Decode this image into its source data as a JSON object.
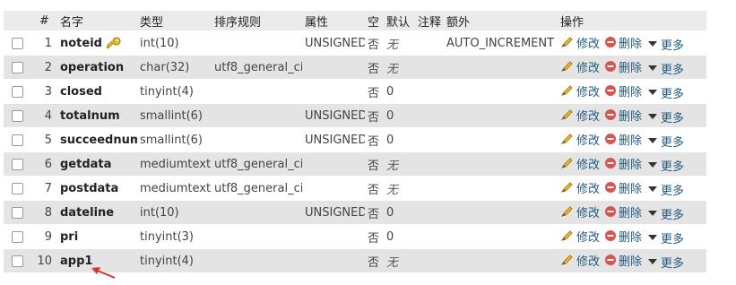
{
  "headers": {
    "index": "#",
    "name": "名字",
    "type": "类型",
    "collation": "排序规则",
    "attributes": "属性",
    "null": "空",
    "default": "默认",
    "comment": "注释",
    "extra": "额外",
    "actions": "操作"
  },
  "actions": {
    "edit": "修改",
    "drop": "删除",
    "more": "更多"
  },
  "icons": {
    "primary_key": "key-icon",
    "edit": "pencil-icon",
    "drop": "delete-circle-icon",
    "more": "dropdown-triangle-icon"
  },
  "rows": [
    {
      "index": "1",
      "name": "noteid",
      "primary_key": true,
      "type": "int(10)",
      "collation": "",
      "attributes": "UNSIGNED",
      "null": "否",
      "default": "无",
      "comment": "",
      "extra": "AUTO_INCREMENT"
    },
    {
      "index": "2",
      "name": "operation",
      "type": "char(32)",
      "collation": "utf8_general_ci",
      "attributes": "",
      "null": "否",
      "default": "无",
      "comment": "",
      "extra": ""
    },
    {
      "index": "3",
      "name": "closed",
      "type": "tinyint(4)",
      "collation": "",
      "attributes": "",
      "null": "否",
      "default": "0",
      "comment": "",
      "extra": ""
    },
    {
      "index": "4",
      "name": "totalnum",
      "type": "smallint(6)",
      "collation": "",
      "attributes": "UNSIGNED",
      "null": "否",
      "default": "0",
      "comment": "",
      "extra": ""
    },
    {
      "index": "5",
      "name": "succeednum",
      "type": "smallint(6)",
      "collation": "",
      "attributes": "UNSIGNED",
      "null": "否",
      "default": "0",
      "comment": "",
      "extra": ""
    },
    {
      "index": "6",
      "name": "getdata",
      "type": "mediumtext",
      "collation": "utf8_general_ci",
      "attributes": "",
      "null": "否",
      "default": "无",
      "comment": "",
      "extra": ""
    },
    {
      "index": "7",
      "name": "postdata",
      "type": "mediumtext",
      "collation": "utf8_general_ci",
      "attributes": "",
      "null": "否",
      "default": "无",
      "comment": "",
      "extra": ""
    },
    {
      "index": "8",
      "name": "dateline",
      "type": "int(10)",
      "collation": "",
      "attributes": "UNSIGNED",
      "null": "否",
      "default": "0",
      "comment": "",
      "extra": ""
    },
    {
      "index": "9",
      "name": "pri",
      "type": "tinyint(3)",
      "collation": "",
      "attributes": "",
      "null": "否",
      "default": "0",
      "comment": "",
      "extra": ""
    },
    {
      "index": "10",
      "name": "app1",
      "type": "tinyint(4)",
      "collation": "",
      "attributes": "",
      "null": "否",
      "default": "无",
      "comment": "",
      "extra": ""
    }
  ],
  "colors": {
    "header_bg": "#ebebeb",
    "row_even_bg": "#e4e4e4",
    "link": "#235a81",
    "drop_icon": "#d9534f",
    "edit_icon": "#e0a800",
    "annotation_arrow": "#d9342b"
  }
}
